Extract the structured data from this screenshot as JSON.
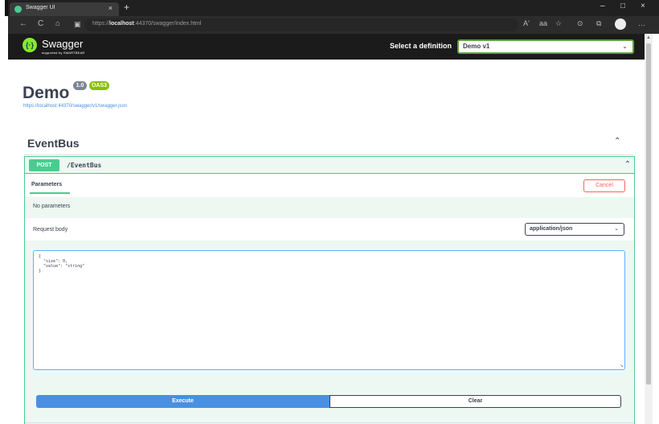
{
  "browser": {
    "tab_title": "Swagger UI",
    "tab_close": "×",
    "new_tab": "+",
    "minimize": "–",
    "restore": "□",
    "close": "×",
    "back": "←",
    "reload": "C",
    "home": "⌂",
    "url_prefix": "https://",
    "url_host": "localhost",
    "url_rest": ":44370/swagger/index.html",
    "right_icons": [
      "Aʹ",
      "aa",
      "☆",
      "⊙",
      "⧉",
      "…"
    ]
  },
  "swagger": {
    "logo_letter": "{·}",
    "logo_text": "Swagger",
    "logo_sub": "supported by SMARTBEAR",
    "definition_label": "Select a definition",
    "definition_value": "Demo v1"
  },
  "info": {
    "title": "Demo",
    "version": "1.0",
    "oas": "OAS3",
    "spec_url": "https://localhost:44370/swagger/v1/swagger.json"
  },
  "tag": {
    "name": "EventBus"
  },
  "operation": {
    "method": "POST",
    "path": "/EventBus",
    "parameters_tab": "Parameters",
    "cancel_label": "Cancel",
    "no_params": "No parameters",
    "request_body_label": "Request body",
    "content_type": "application/json",
    "body_text": "{\n  \"size\": 0,\n  \"value\": \"string\"\n}",
    "execute_label": "Execute",
    "clear_label": "Clear"
  },
  "colors": {
    "post_green": "#49cc90",
    "execute_blue": "#4990e2",
    "cancel_red": "#ff6060"
  }
}
